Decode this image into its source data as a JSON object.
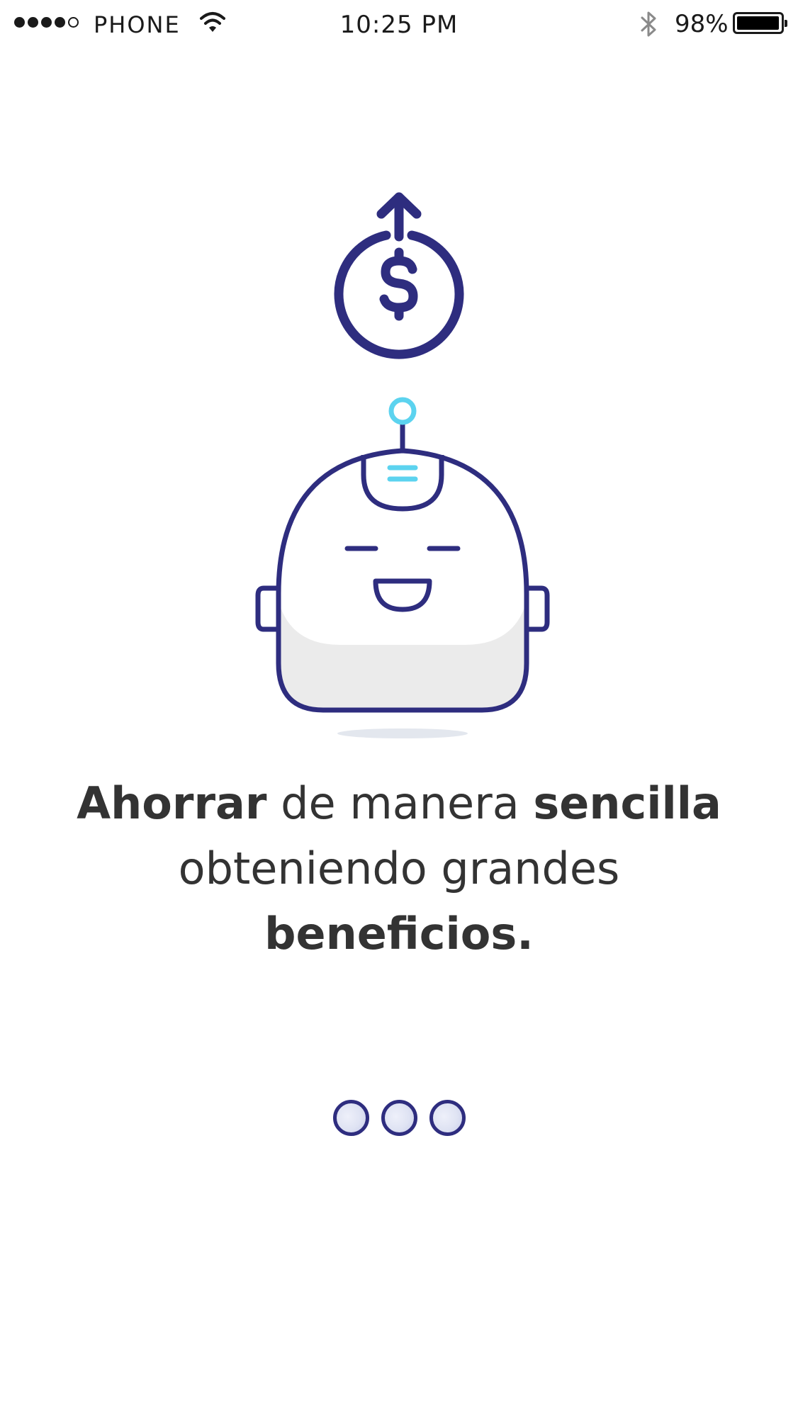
{
  "status_bar": {
    "carrier": "PHONE",
    "time": "10:25 PM",
    "battery_percent": "98%",
    "signal_bars": 4,
    "signal_max": 5,
    "battery_level": 0.98,
    "icons": [
      "signal-icon",
      "wifi-icon",
      "bluetooth-icon",
      "battery-icon"
    ]
  },
  "illustration": {
    "coin_icon": "dollar-up-arrow-icon",
    "robot_icon": "smiling-robot-head-icon",
    "colors": {
      "primary": "#2e2d7f",
      "accent": "#5cd3ef",
      "shade": "#ebebeb"
    }
  },
  "headline": {
    "part1_bold": "Ahorrar",
    "part2": " de manera ",
    "part3_bold": "sencilla",
    "part4": "obteniendo grandes",
    "part5_bold": "beneficios."
  },
  "pager": {
    "pages": 3,
    "dot_color": "#2e2d7f"
  }
}
